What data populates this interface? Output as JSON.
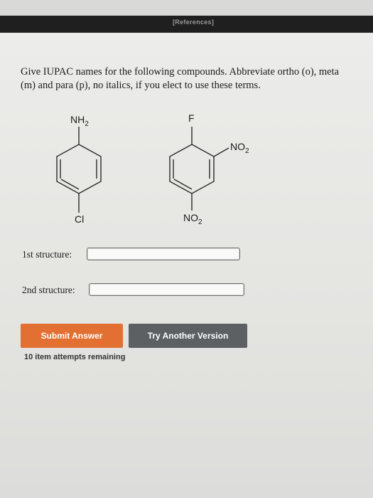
{
  "header": {
    "references_label": "[References]"
  },
  "question": {
    "text": "Give IUPAC names for the following compounds. Abbreviate ortho (o), meta (m) and para (p), no italics, if you elect to use these terms."
  },
  "structures": [
    {
      "top_substituent": "NH",
      "top_subscript": "2",
      "bottom_substituent": "Cl"
    },
    {
      "top_substituent": "F",
      "side_substituent": "NO",
      "side_subscript": "2",
      "bottom_substituent": "NO",
      "bottom_subscript": "2"
    }
  ],
  "answers": {
    "first": {
      "label": "1st structure:",
      "value": ""
    },
    "second": {
      "label": "2nd structure:",
      "value": ""
    }
  },
  "buttons": {
    "submit": "Submit Answer",
    "try_another": "Try Another Version"
  },
  "status": {
    "attempts": "10 item attempts remaining"
  },
  "colors": {
    "submit": "#e27033",
    "try_another": "#5c6063",
    "header_bar": "#1f1f1f"
  }
}
